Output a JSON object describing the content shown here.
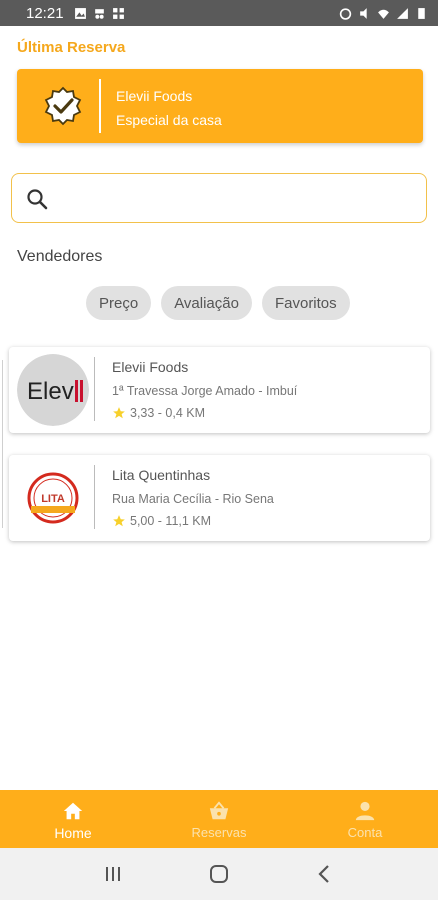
{
  "status_bar": {
    "time": "12:21"
  },
  "last_reservation": {
    "title": "Última Reserva",
    "vendor": "Elevii Foods",
    "item": "Especial da casa"
  },
  "search": {
    "placeholder": ""
  },
  "vendors_section": {
    "title": "Vendedores"
  },
  "filters": [
    {
      "label": "Preço"
    },
    {
      "label": "Avaliação"
    },
    {
      "label": "Favoritos"
    }
  ],
  "vendors": [
    {
      "name": "Elevii Foods",
      "address": "1ª Travessa Jorge Amado - Imbuí",
      "rating_distance": "3,33 - 0,4 KM",
      "logo_text": "Elev"
    },
    {
      "name": "Lita Quentinhas",
      "address": "Rua Maria Cecília - Rio Sena",
      "rating_distance": "5,00 - 11,1 KM",
      "logo_text": "LITA"
    }
  ],
  "bottom_nav": [
    {
      "label": "Home",
      "icon": "home-icon",
      "active": true
    },
    {
      "label": "Reservas",
      "icon": "basket-icon",
      "active": false
    },
    {
      "label": "Conta",
      "icon": "person-icon",
      "active": false
    }
  ],
  "colors": {
    "accent": "#FFAE1A",
    "accent_text": "#F5A81D",
    "chip": "#E1E1E1",
    "star": "#F7D02B"
  }
}
